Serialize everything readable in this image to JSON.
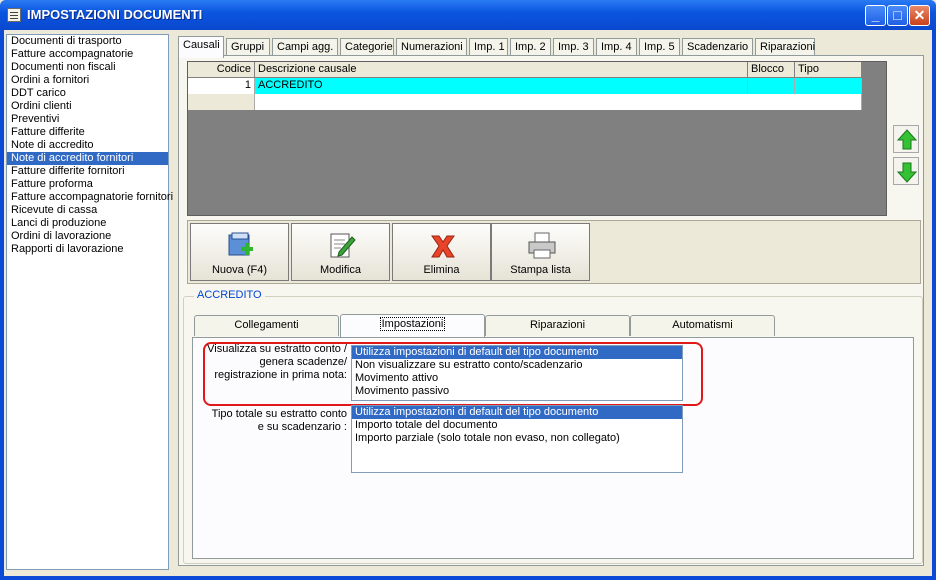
{
  "window": {
    "title": "IMPOSTAZIONI DOCUMENTI",
    "minimize": "_",
    "maximize": "□",
    "close": "✕"
  },
  "doc_types": [
    "Documenti di trasporto",
    "Fatture accompagnatorie",
    "Documenti non fiscali",
    "Ordini a fornitori",
    "DDT carico",
    "Ordini clienti",
    "Preventivi",
    "Fatture differite",
    "Note di accredito",
    "Note di accredito fornitori",
    "Fatture differite fornitori",
    "Fatture proforma",
    "Fatture accompagnatorie fornitori",
    "Ricevute di cassa",
    "Lanci di produzione",
    "Ordini di lavorazione",
    "Rapporti di lavorazione"
  ],
  "selected_doc_type": "Note di accredito fornitori",
  "tabs": [
    "Causali",
    "Gruppi",
    "Campi agg.",
    "Categorie",
    "Numerazioni",
    "Imp. 1",
    "Imp. 2",
    "Imp. 3",
    "Imp. 4",
    "Imp. 5",
    "Scadenzario",
    "Riparazioni"
  ],
  "active_tab": "Causali",
  "grid": {
    "headers": [
      "Codice",
      "Descrizione causale",
      "Blocco",
      "Tipo"
    ],
    "rows": [
      {
        "codice": "1",
        "descrizione": "ACCREDITO",
        "blocco": "",
        "tipo": ""
      }
    ]
  },
  "toolbar": {
    "new_label": "Nuova (F4)",
    "edit_label": "Modifica",
    "delete_label": "Elimina",
    "print_label": "Stampa lista"
  },
  "group_title": "ACCREDITO",
  "subtabs": [
    "Collegamenti",
    "Impostazioni",
    "Riparazioni",
    "Automatismi"
  ],
  "active_subtab": "Impostazioni",
  "field1": {
    "label_line1": "Visualizza su estratto conto /",
    "label_line2": "genera scadenze/",
    "label_line3": "registrazione  in prima nota:",
    "options": [
      "Utilizza impostazioni di default del tipo documento",
      "Non visualizzare su estratto conto/scadenzario",
      "Movimento attivo",
      "Movimento passivo"
    ],
    "selected_index": 0
  },
  "field2": {
    "label_line1": "Tipo totale su estratto conto",
    "label_line2": "e su scadenzario :",
    "options": [
      "Utilizza impostazioni di default del tipo documento",
      "Importo totale del documento",
      "Importo parziale (solo totale non evaso, non collegato)"
    ],
    "selected_index": 0
  },
  "colors": {
    "titlebar": "#0a48cf",
    "selection": "#316ac5",
    "grid_row": "#00ffff",
    "highlight_box": "#e01818",
    "group_title": "#0046d5"
  }
}
